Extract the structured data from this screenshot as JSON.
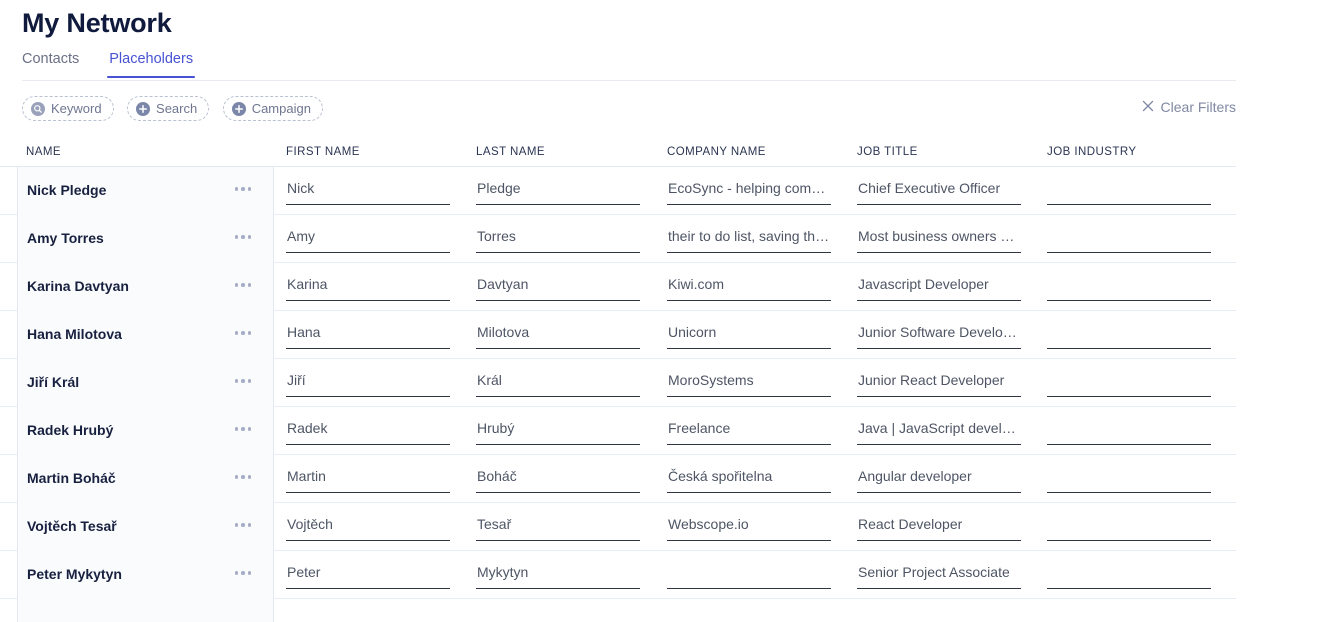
{
  "header": {
    "title": "My Network"
  },
  "tabs": [
    {
      "label": "Contacts",
      "active": false
    },
    {
      "label": "Placeholders",
      "active": true
    }
  ],
  "filters": {
    "chips": [
      {
        "label": "Keyword",
        "icon": "search-circle-icon"
      },
      {
        "label": "Search",
        "icon": "plus-circle-icon"
      },
      {
        "label": "Campaign",
        "icon": "plus-circle-icon"
      }
    ],
    "clear_label": "Clear Filters",
    "clear_icon": "close-icon"
  },
  "table": {
    "columns": [
      "NAME",
      "FIRST NAME",
      "LAST NAME",
      "COMPANY NAME",
      "JOB TITLE",
      "JOB INDUSTRY"
    ],
    "rows": [
      {
        "name": "Nick Pledge",
        "first_name": "Nick",
        "last_name": "Pledge",
        "company_name": "EcoSync - helping comm…",
        "job_title": "Chief Executive Officer",
        "job_industry": ""
      },
      {
        "name": "Amy Torres",
        "first_name": "Amy",
        "last_name": "Torres",
        "company_name": "their to do list, saving th…",
        "job_title": "Most business owners str…",
        "job_industry": ""
      },
      {
        "name": "Karina Davtyan",
        "first_name": "Karina",
        "last_name": "Davtyan",
        "company_name": "Kiwi.com",
        "job_title": "Javascript Developer",
        "job_industry": ""
      },
      {
        "name": "Hana Milotova",
        "first_name": "Hana",
        "last_name": "Milotova",
        "company_name": "Unicorn",
        "job_title": "Junior Software Developer",
        "job_industry": ""
      },
      {
        "name": "Jiří Král",
        "first_name": "Jiří",
        "last_name": "Král",
        "company_name": "MoroSystems",
        "job_title": "Junior React Developer",
        "job_industry": ""
      },
      {
        "name": "Radek Hrubý",
        "first_name": "Radek",
        "last_name": "Hrubý",
        "company_name": "Freelance",
        "job_title": "Java | JavaScript developer",
        "job_industry": ""
      },
      {
        "name": "Martin Boháč",
        "first_name": "Martin",
        "last_name": "Boháč",
        "company_name": "Česká spořitelna",
        "job_title": "Angular developer",
        "job_industry": ""
      },
      {
        "name": "Vojtěch Tesař",
        "first_name": "Vojtěch",
        "last_name": "Tesař",
        "company_name": "Webscope.io",
        "job_title": "React Developer",
        "job_industry": ""
      },
      {
        "name": "Peter Mykytyn",
        "first_name": "Peter",
        "last_name": "Mykytyn",
        "company_name": "",
        "job_title": "Senior Project Associate",
        "job_industry": ""
      }
    ]
  },
  "colors": {
    "accent": "#4853d4",
    "title": "#0f1a3c",
    "muted": "#6f7690",
    "field_underline": "#2f3542",
    "row_border": "#e8edf5"
  }
}
